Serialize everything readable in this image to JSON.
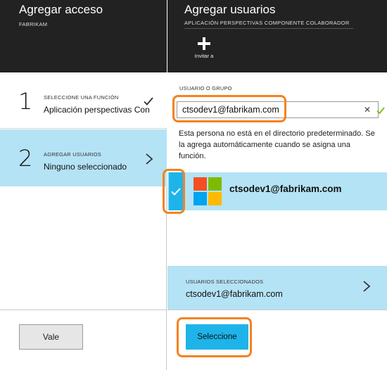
{
  "left_blade": {
    "title": "Agregar acceso",
    "subtitle": "FABRIKAM",
    "steps": [
      {
        "number": "1",
        "caption": "SELECCIONE UNA FUNCIÓN",
        "value": "Aplicación perspectivas Con..."
      },
      {
        "number": "2",
        "caption": "AGREGAR USUARIOS",
        "value": "Ninguno seleccionado"
      }
    ],
    "ok_button": "Vale"
  },
  "right_blade": {
    "title": "Agregar usuarios",
    "subtitle": "APLICACIÓN PERSPECTIVAS COMPONENTE COLABORADOR",
    "invite_label": "Invitar a",
    "search": {
      "caption": "USUARIO O GRUPO",
      "value": "ctsodev1@fabrikam.com",
      "clear_glyph": "✕"
    },
    "info_text": "Esta persona no está en el directorio predeterminado. Se la agrega automáticamente cuando se asigna una función.",
    "results": [
      {
        "email": "ctsodev1@fabrikam.com",
        "selected": true,
        "icon": "microsoft-logo-icon"
      }
    ],
    "selected_users": {
      "caption": "USUARIOS SELECCIONADOS",
      "value": "ctsodev1@fabrikam.com"
    },
    "select_button": "Seleccione"
  },
  "colors": {
    "header_bg": "#222222",
    "selected_bg": "#b4e3f5",
    "accent_blue": "#1eb4ea",
    "highlight_orange": "#f58220",
    "ms_red": "#f25022",
    "ms_green": "#7fba00",
    "ms_blue": "#00a4ef",
    "ms_yellow": "#ffb900"
  }
}
